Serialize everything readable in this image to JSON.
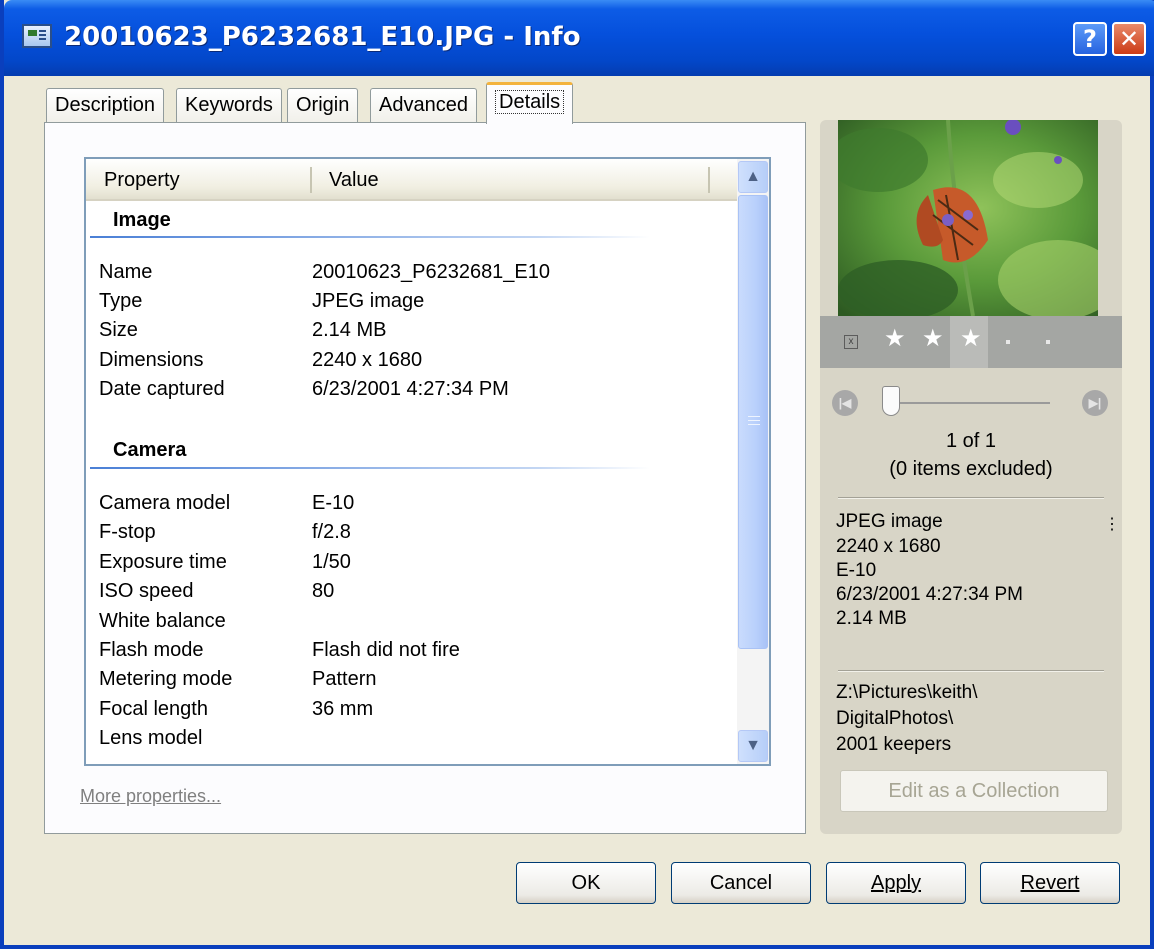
{
  "window": {
    "title": "20010623_P6232681_E10.JPG - Info",
    "help_label": "?",
    "close_label": "✕"
  },
  "tabs": [
    {
      "label": "Description"
    },
    {
      "label": "Keywords"
    },
    {
      "label": "Origin"
    },
    {
      "label": "Advanced"
    },
    {
      "label": "Details",
      "active": true
    }
  ],
  "list": {
    "columns": [
      "Property",
      "Value"
    ],
    "groups": [
      {
        "title": "Image",
        "rows": [
          {
            "key": "Name",
            "value": "20010623_P6232681_E10"
          },
          {
            "key": "Type",
            "value": "JPEG image"
          },
          {
            "key": "Size",
            "value": "2.14 MB"
          },
          {
            "key": "Dimensions",
            "value": "2240 x 1680"
          },
          {
            "key": "Date captured",
            "value": "6/23/2001 4:27:34 PM"
          }
        ]
      },
      {
        "title": "Camera",
        "rows": [
          {
            "key": "Camera model",
            "value": "E-10"
          },
          {
            "key": "F-stop",
            "value": "f/2.8"
          },
          {
            "key": "Exposure time",
            "value": "1/50"
          },
          {
            "key": "ISO speed",
            "value": "80"
          },
          {
            "key": "White balance",
            "value": ""
          },
          {
            "key": "Flash mode",
            "value": "Flash did not fire"
          },
          {
            "key": "Metering mode",
            "value": "Pattern"
          },
          {
            "key": "Focal length",
            "value": "36 mm"
          },
          {
            "key": "Lens model",
            "value": ""
          }
        ]
      }
    ]
  },
  "more_properties_link": "More properties...",
  "preview": {
    "rating": 3,
    "position_label": "1 of 1",
    "excluded_label": "(0 items excluded)",
    "summary": [
      "JPEG image",
      "2240 x 1680",
      "E-10",
      "6/23/2001 4:27:34 PM",
      "2.14 MB"
    ],
    "path": [
      "Z:\\Pictures\\keith\\",
      "DigitalPhotos\\",
      "2001  keepers"
    ],
    "edit_collection_label": "Edit as a Collection"
  },
  "buttons": {
    "ok": "OK",
    "cancel": "Cancel",
    "apply": "Apply",
    "revert": "Revert"
  },
  "colors": {
    "title_bar": "#0550dc",
    "dialog_bg": "#ece9d8",
    "active_tab_accent": "#f3b33d",
    "link": "#7f7f7f"
  }
}
